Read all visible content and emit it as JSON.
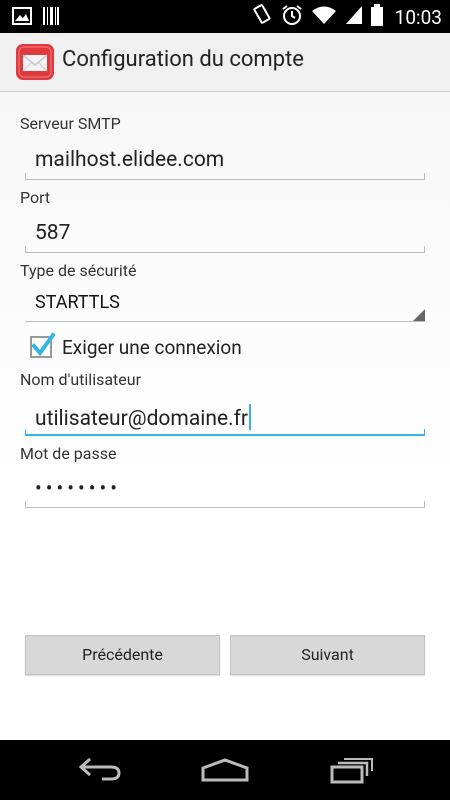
{
  "status_bar": {
    "time": "10:03",
    "icons": [
      "image-icon",
      "barcode-icon",
      "rotate-icon",
      "alarm-icon",
      "wifi-icon",
      "battery-icon"
    ]
  },
  "action_bar": {
    "title": "Configuration du compte",
    "icon": "mail-app-icon"
  },
  "form": {
    "smtp_label": "Serveur SMTP",
    "smtp_value": "mailhost.elidee.com",
    "port_label": "Port",
    "port_value": "587",
    "security_label": "Type de sécurité",
    "security_value": "STARTTLS",
    "require_login_label": "Exiger une connexion",
    "require_login_checked": true,
    "username_label": "Nom d'utilisateur",
    "username_value": "utilisateur@domaine.fr",
    "password_label": "Mot de passe",
    "password_value": "••••••••"
  },
  "buttons": {
    "previous": "Précédente",
    "next": "Suivant"
  },
  "nav_bar": {
    "icons": [
      "back-icon",
      "home-icon",
      "recents-icon"
    ]
  },
  "colors": {
    "accent": "#33b5e5",
    "app_icon_red": "#e0393e"
  }
}
